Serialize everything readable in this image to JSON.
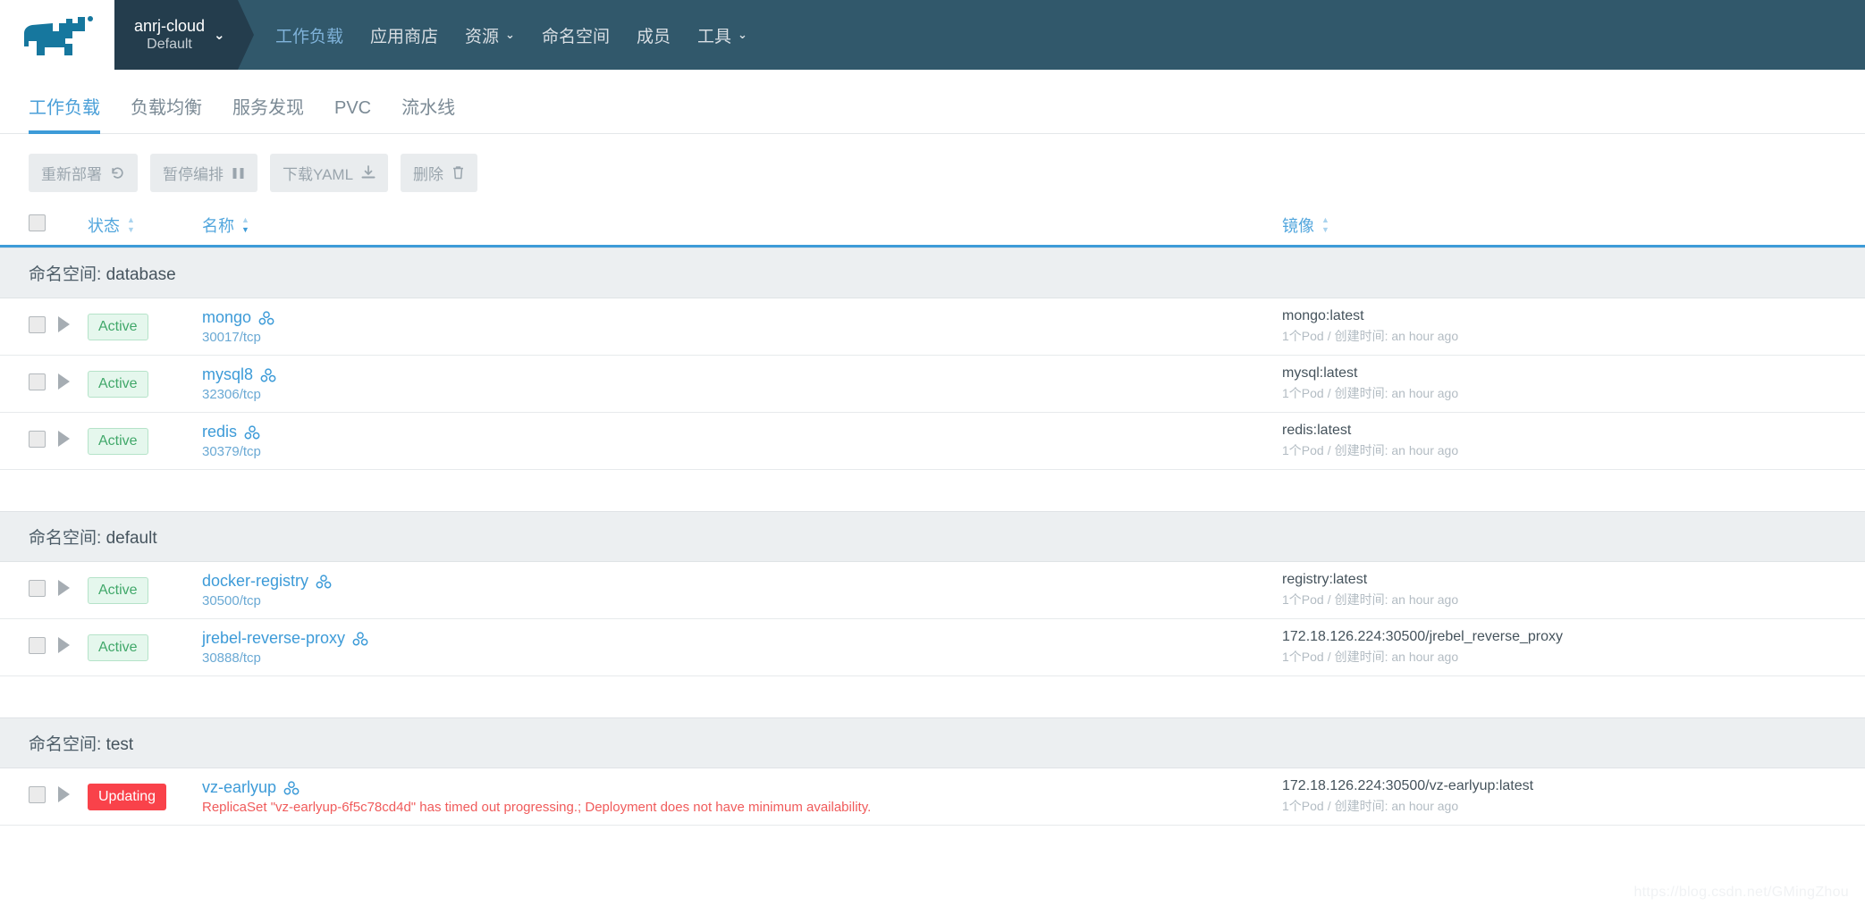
{
  "header": {
    "logo_icon": "rancher-cow-logo",
    "cluster": {
      "name": "anrj-cloud",
      "project": "Default",
      "caret": "⌄"
    },
    "nav": [
      {
        "label": "工作负载",
        "active": true,
        "caret": ""
      },
      {
        "label": "应用商店",
        "active": false,
        "caret": ""
      },
      {
        "label": "资源",
        "active": false,
        "caret": "⌄"
      },
      {
        "label": "命名空间",
        "active": false,
        "caret": ""
      },
      {
        "label": "成员",
        "active": false,
        "caret": ""
      },
      {
        "label": "工具",
        "active": false,
        "caret": "⌄"
      }
    ]
  },
  "subtabs": [
    {
      "label": "工作负载",
      "active": true
    },
    {
      "label": "负载均衡",
      "active": false
    },
    {
      "label": "服务发现",
      "active": false
    },
    {
      "label": "PVC",
      "active": false
    },
    {
      "label": "流水线",
      "active": false
    }
  ],
  "toolbar": [
    {
      "label": "重新部署",
      "icon": "redeploy-icon"
    },
    {
      "label": "暂停编排",
      "icon": "pause-icon"
    },
    {
      "label": "下载YAML",
      "icon": "download-icon"
    },
    {
      "label": "删除",
      "icon": "trash-icon"
    }
  ],
  "table": {
    "columns": {
      "state": {
        "label": "状态",
        "sort": "none"
      },
      "name": {
        "label": "名称",
        "sort": "desc"
      },
      "image": {
        "label": "镜像",
        "sort": "none"
      }
    },
    "pod_label": "1个Pod",
    "separator": "/",
    "created_label": "创建时间:",
    "created_value": "an hour ago",
    "namespace_prefix": "命名空间:",
    "groups": [
      {
        "namespace": "database",
        "rows": [
          {
            "state": "Active",
            "state_kind": "active",
            "name": "mongo",
            "sub": "30017/tcp",
            "sub_kind": "port",
            "image": "mongo:latest"
          },
          {
            "state": "Active",
            "state_kind": "active",
            "name": "mysql8",
            "sub": "32306/tcp",
            "sub_kind": "port",
            "image": "mysql:latest"
          },
          {
            "state": "Active",
            "state_kind": "active",
            "name": "redis",
            "sub": "30379/tcp",
            "sub_kind": "port",
            "image": "redis:latest"
          }
        ]
      },
      {
        "namespace": "default",
        "rows": [
          {
            "state": "Active",
            "state_kind": "active",
            "name": "docker-registry",
            "sub": "30500/tcp",
            "sub_kind": "port",
            "image": "registry:latest"
          },
          {
            "state": "Active",
            "state_kind": "active",
            "name": "jrebel-reverse-proxy",
            "sub": "30888/tcp",
            "sub_kind": "port",
            "image": "172.18.126.224:30500/jrebel_reverse_proxy"
          }
        ]
      },
      {
        "namespace": "test",
        "rows": [
          {
            "state": "Updating",
            "state_kind": "updating",
            "name": "vz-earlyup",
            "sub": "ReplicaSet \"vz-earlyup-6f5c78cd4d\" has timed out progressing.; Deployment does not have minimum availability.",
            "sub_kind": "error",
            "image": "172.18.126.224:30500/vz-earlyup:latest"
          }
        ]
      }
    ]
  },
  "watermark": "https://blog.csdn.net/GMingZhou"
}
